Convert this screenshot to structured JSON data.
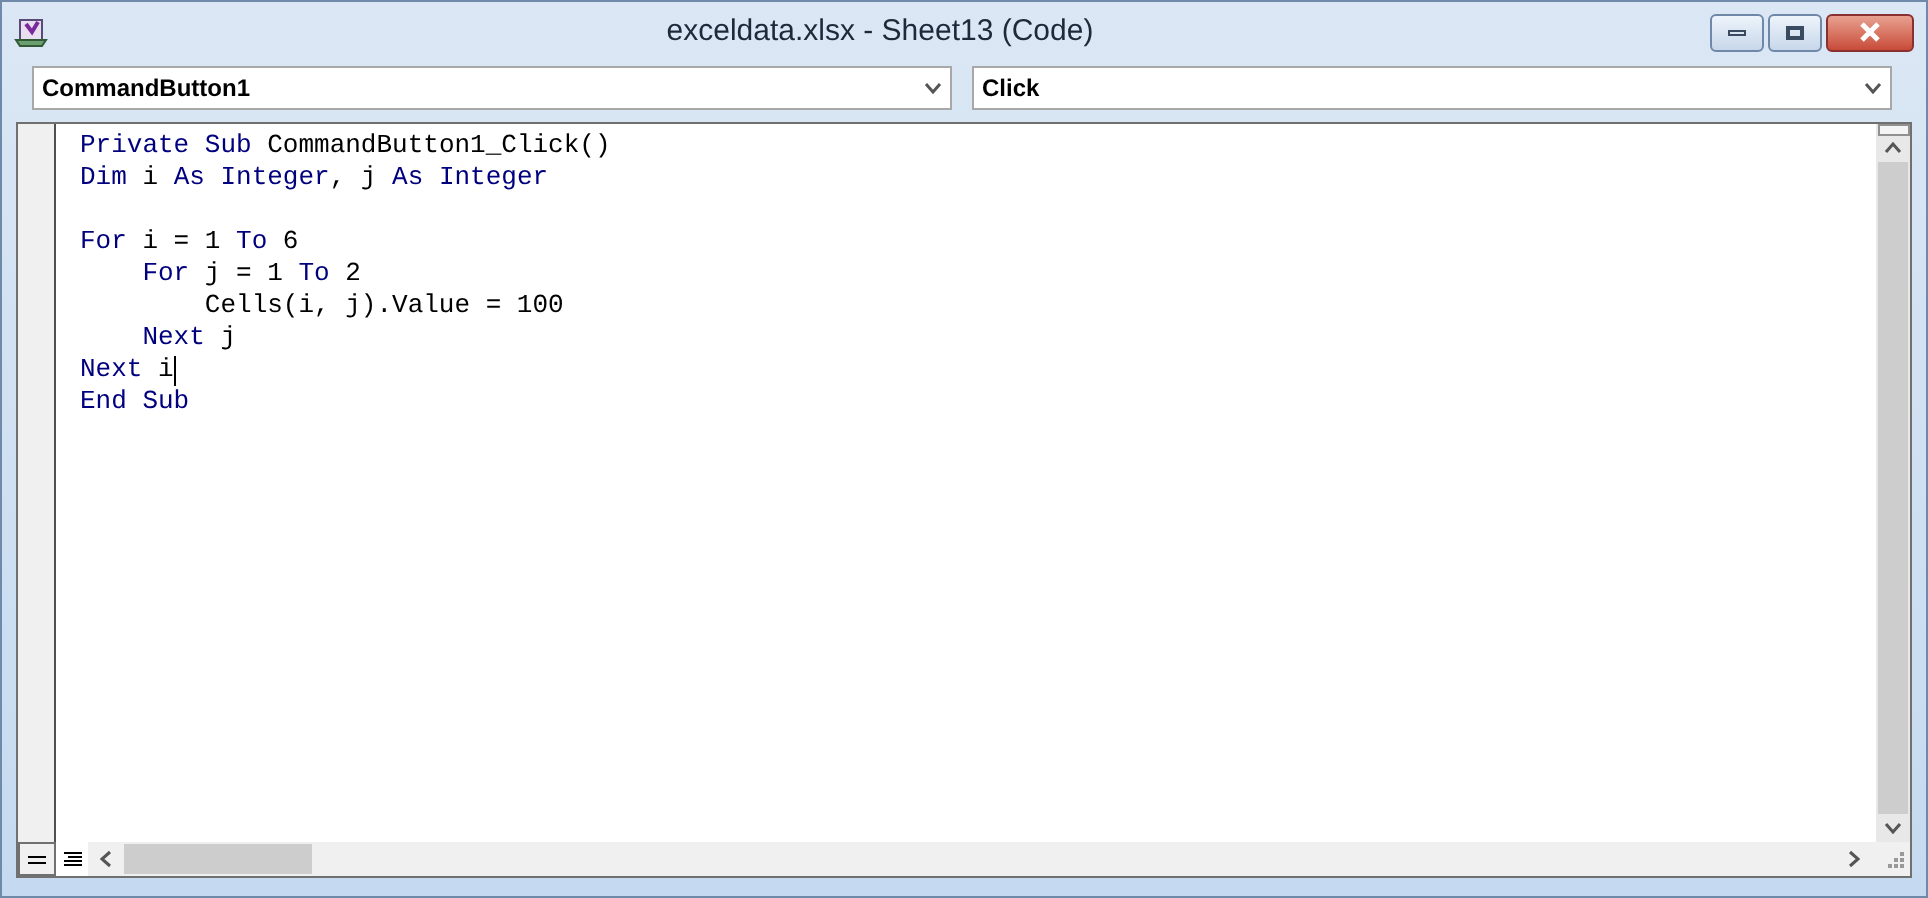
{
  "window": {
    "title": "exceldata.xlsx - Sheet13 (Code)"
  },
  "object_dropdown": {
    "value": "CommandButton1"
  },
  "procedure_dropdown": {
    "value": "Click"
  },
  "code_lines": [
    {
      "segments": [
        {
          "kind": "keyword",
          "text": "Private Sub"
        },
        {
          "kind": "plain",
          "text": " CommandButton1_Click()"
        }
      ],
      "caret": false
    },
    {
      "segments": [
        {
          "kind": "keyword",
          "text": "Dim"
        },
        {
          "kind": "plain",
          "text": " i "
        },
        {
          "kind": "keyword",
          "text": "As Integer"
        },
        {
          "kind": "plain",
          "text": ", j "
        },
        {
          "kind": "keyword",
          "text": "As Integer"
        }
      ],
      "caret": false
    },
    {
      "caret": false
    },
    {
      "segments": [
        {
          "kind": "keyword",
          "text": "For"
        },
        {
          "kind": "plain",
          "text": " i = 1 "
        },
        {
          "kind": "keyword",
          "text": "To"
        },
        {
          "kind": "plain",
          "text": " 6"
        }
      ],
      "caret": false
    },
    {
      "segments": [
        {
          "kind": "keyword",
          "text": "    For"
        },
        {
          "kind": "plain",
          "text": " j = 1 "
        },
        {
          "kind": "keyword",
          "text": "To"
        },
        {
          "kind": "plain",
          "text": " 2"
        }
      ],
      "caret": false
    },
    {
      "segments": [
        {
          "kind": "plain",
          "text": "        Cells(i, j).Value = 100"
        }
      ],
      "caret": false
    },
    {
      "segments": [
        {
          "kind": "keyword",
          "text": "    Next"
        },
        {
          "kind": "plain",
          "text": " j"
        }
      ],
      "caret": false
    },
    {
      "segments": [
        {
          "kind": "keyword",
          "text": "Next"
        },
        {
          "kind": "plain",
          "text": " i"
        }
      ],
      "caret": true
    },
    {
      "segments": [
        {
          "kind": "keyword",
          "text": "End Sub"
        }
      ],
      "caret": false
    }
  ]
}
